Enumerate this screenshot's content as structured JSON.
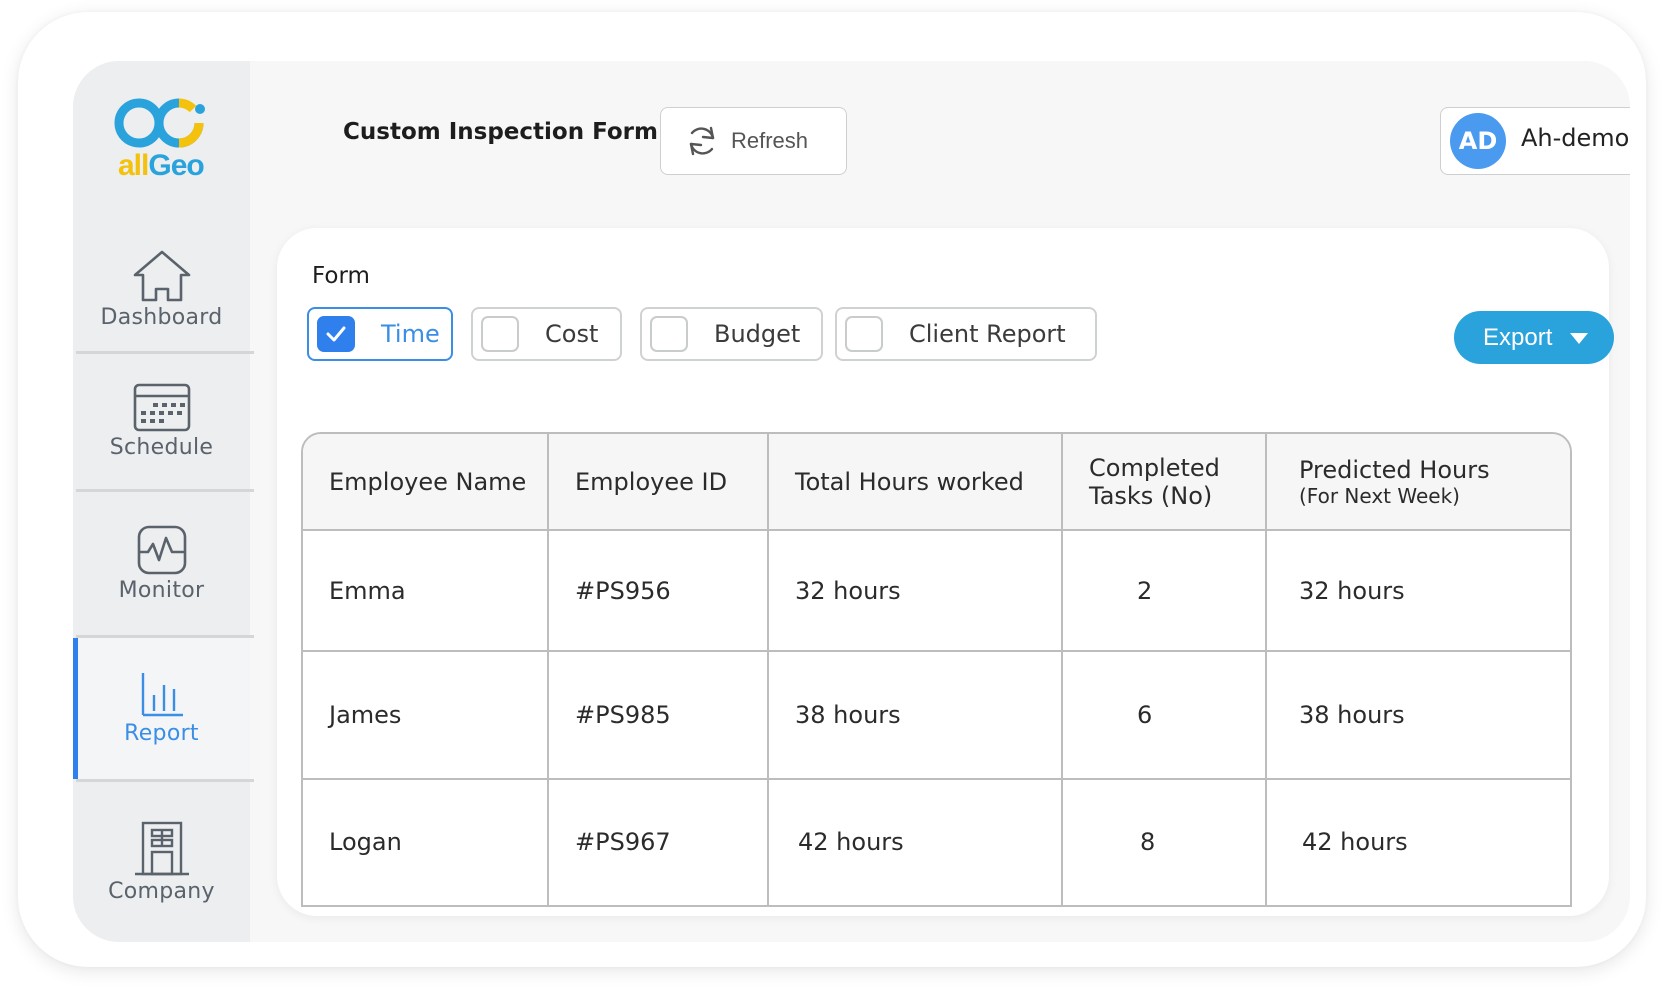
{
  "brand": {
    "logo_text_a": "all",
    "logo_text_b": "Geo",
    "colors": {
      "yellow": "#f4c20d",
      "blue": "#2aa3dc"
    }
  },
  "sidebar": {
    "items": [
      {
        "label": "Dashboard",
        "icon": "home-icon",
        "active": false
      },
      {
        "label": "Schedule",
        "icon": "calendar-icon",
        "active": false
      },
      {
        "label": "Monitor",
        "icon": "monitor-pulse-icon",
        "active": false
      },
      {
        "label": "Report",
        "icon": "bar-chart-icon",
        "active": true
      },
      {
        "label": "Company",
        "icon": "building-icon",
        "active": false
      }
    ]
  },
  "header": {
    "title": "Custom Inspection Form",
    "refresh_label": "Refresh",
    "user": {
      "initials": "AD",
      "name": "Ah-demo"
    }
  },
  "form": {
    "label": "Form",
    "options": [
      {
        "label": "Time",
        "checked": true
      },
      {
        "label": "Cost",
        "checked": false
      },
      {
        "label": "Budget",
        "checked": false
      },
      {
        "label": "Client Report",
        "checked": false
      }
    ],
    "export_label": "Export"
  },
  "table": {
    "columns": [
      {
        "title": "Employee Name",
        "sub": ""
      },
      {
        "title": "Employee ID",
        "sub": ""
      },
      {
        "title": "Total Hours worked",
        "sub": ""
      },
      {
        "title": "Completed Tasks (No)",
        "sub": ""
      },
      {
        "title": "Predicted Hours",
        "sub": "(For Next Week)"
      }
    ],
    "rows": [
      {
        "name": "Emma",
        "id": "#PS956",
        "hours": "32 hours",
        "tasks": "2",
        "predicted": "32 hours"
      },
      {
        "name": "James",
        "id": "#PS985",
        "hours": "38 hours",
        "tasks": "6",
        "predicted": "38 hours"
      },
      {
        "name": "Logan",
        "id": "#PS967",
        "hours": "42 hours",
        "tasks": "8",
        "predicted": "42 hours"
      }
    ]
  },
  "accent_colors": {
    "primary": "#2f80ed",
    "export": "#2aa3dc",
    "avatar": "#4a9af0"
  }
}
